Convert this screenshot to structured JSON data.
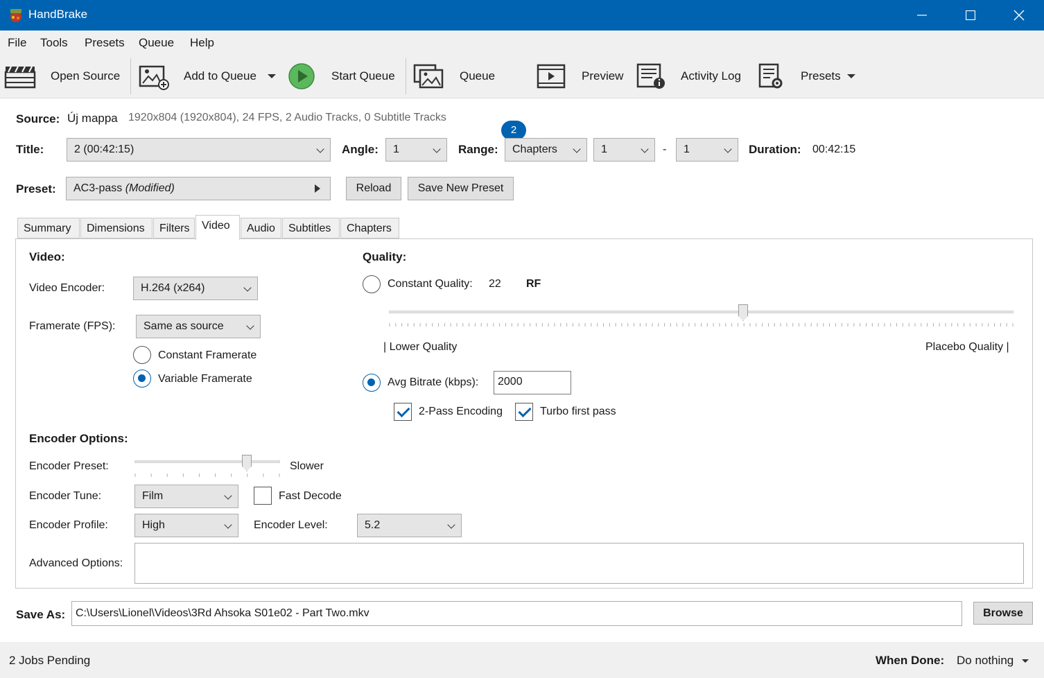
{
  "window": {
    "title": "HandBrake"
  },
  "menu": [
    "File",
    "Tools",
    "Presets",
    "Queue",
    "Help"
  ],
  "toolbar": {
    "open_source": "Open Source",
    "add_to_queue": "Add to Queue",
    "start_queue": "Start Queue",
    "queue": "Queue",
    "queue_count": "2",
    "preview": "Preview",
    "activity_log": "Activity Log",
    "presets": "Presets"
  },
  "source": {
    "label": "Source:",
    "name": "Új mappa",
    "info": "1920x804 (1920x804), 24 FPS, 2 Audio Tracks, 0 Subtitle Tracks"
  },
  "title_row": {
    "title_label": "Title:",
    "title_value": "2  (00:42:15)",
    "angle_label": "Angle:",
    "angle_value": "1",
    "range_label": "Range:",
    "range_type": "Chapters",
    "range_start": "1",
    "range_sep": "-",
    "range_end": "1",
    "duration_label": "Duration:",
    "duration_value": "00:42:15"
  },
  "preset_row": {
    "label": "Preset:",
    "name": "AC3-pass",
    "modified": "(Modified)",
    "reload": "Reload",
    "save_new": "Save New Preset"
  },
  "tabs": [
    "Summary",
    "Dimensions",
    "Filters",
    "Video",
    "Audio",
    "Subtitles",
    "Chapters"
  ],
  "active_tab": "Video",
  "video": {
    "heading": "Video:",
    "encoder_label": "Video Encoder:",
    "encoder_value": "H.264 (x264)",
    "framerate_label": "Framerate (FPS):",
    "framerate_value": "Same as source",
    "constant_framerate": "Constant Framerate",
    "variable_framerate": "Variable Framerate",
    "framerate_mode": "variable"
  },
  "quality": {
    "heading": "Quality:",
    "constant_quality_label": "Constant Quality:",
    "constant_quality_value": "22",
    "rf_label": "RF",
    "slider_position": 0.57,
    "lower_quality": "| Lower Quality",
    "placebo_quality": "Placebo Quality |",
    "avg_bitrate_label": "Avg Bitrate (kbps):",
    "avg_bitrate_value": "2000",
    "mode": "avg_bitrate",
    "two_pass": "2-Pass Encoding",
    "two_pass_checked": true,
    "turbo": "Turbo first pass",
    "turbo_checked": true
  },
  "encoder_options": {
    "heading": "Encoder Options:",
    "preset_label": "Encoder Preset:",
    "preset_value": "Slower",
    "preset_slider_position": 0.78,
    "tune_label": "Encoder Tune:",
    "tune_value": "Film",
    "fast_decode": "Fast Decode",
    "fast_decode_checked": false,
    "profile_label": "Encoder Profile:",
    "profile_value": "High",
    "level_label": "Encoder Level:",
    "level_value": "5.2",
    "advanced_label": "Advanced Options:",
    "advanced_value": ""
  },
  "save_as": {
    "label": "Save As:",
    "path": "C:\\Users\\Lionel\\Videos\\3Rd   Ahsoka S01e02 - Part Two.mkv",
    "browse": "Browse"
  },
  "status": {
    "jobs": "2 Jobs Pending",
    "when_done_label": "When Done:",
    "when_done_value": "Do nothing"
  },
  "colors": {
    "accent": "#0063b1",
    "play_green": "#5cb85c"
  }
}
